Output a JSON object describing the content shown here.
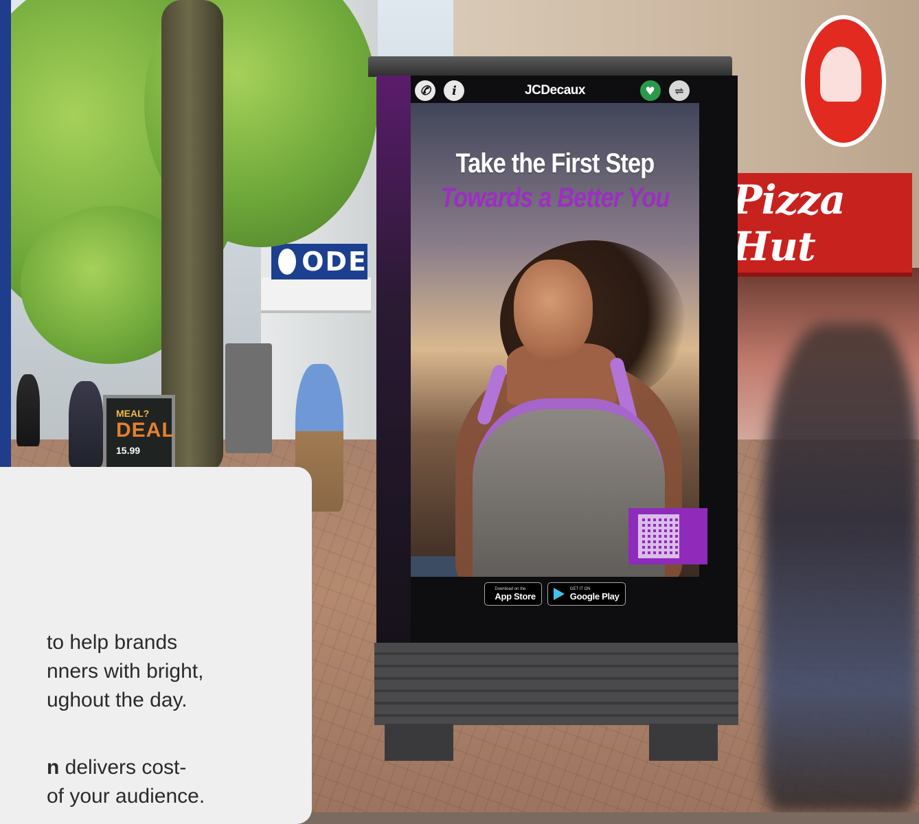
{
  "billboard": {
    "brand": "JCDecaux",
    "headline_line1": "Take the First Step",
    "headline_line2": "Towards a Better You",
    "icons": [
      "phone-icon",
      "info-icon",
      "heart-icon",
      "usb-icon"
    ],
    "store_badges": {
      "app_store_small": "Download on the",
      "app_store_big": "App Store",
      "google_play_small": "GET IT ON",
      "google_play_big": "Google Play"
    },
    "accent_color": "#9b2fc0"
  },
  "street_signs": {
    "pizza_hut": "Pizza Hut",
    "odeon": "ODE",
    "aboard_line1": "MEAL?",
    "aboard_line2": "DEAL",
    "aboard_price": "15.99"
  },
  "card": {
    "paragraph1_lines": [
      "to help brands",
      "nners with bright,",
      "ughout the day."
    ],
    "paragraph2_bold": "n",
    "paragraph2_line1_rest": " delivers cost-",
    "paragraph2_line2": "of your audience."
  }
}
